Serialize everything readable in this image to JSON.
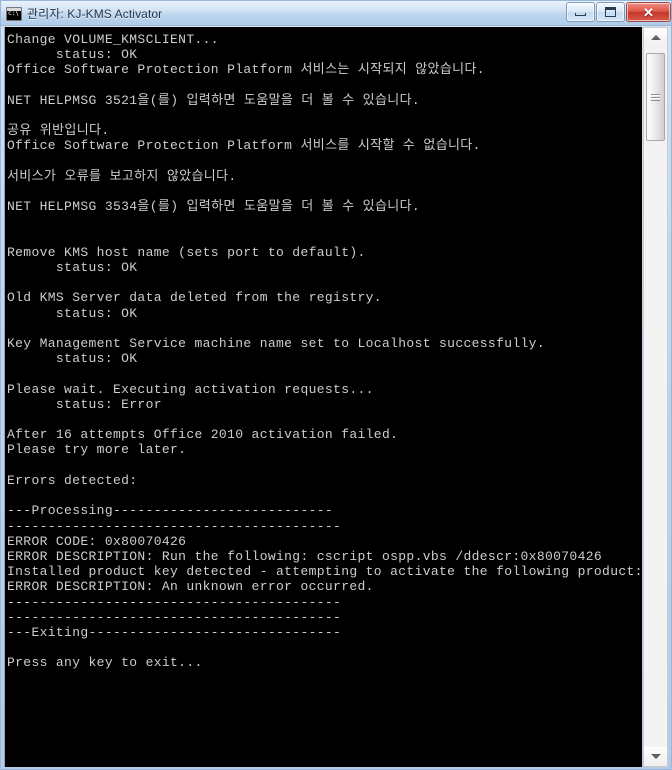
{
  "window": {
    "title": "관리자:  KJ-KMS Activator",
    "icon": "cmd-console-icon"
  },
  "caption_buttons": {
    "minimize_label": "",
    "maximize_label": "",
    "close_label": "✕"
  },
  "scrollbar": {
    "up_arrow": "scroll-up-arrow",
    "down_arrow": "scroll-down-arrow",
    "thumb": "scroll-thumb"
  },
  "console": {
    "lines": [
      "Change VOLUME_KMSCLIENT...",
      "      status: OK",
      "Office Software Protection Platform 서비스는 시작되지 않았습니다.",
      "",
      "NET HELPMSG 3521을(를) 입력하면 도움말을 더 볼 수 있습니다.",
      "",
      "공유 위반입니다.",
      "Office Software Protection Platform 서비스를 시작할 수 없습니다.",
      "",
      "서비스가 오류를 보고하지 않았습니다.",
      "",
      "NET HELPMSG 3534을(를) 입력하면 도움말을 더 볼 수 있습니다.",
      "",
      "",
      "Remove KMS host name (sets port to default).",
      "      status: OK",
      "",
      "Old KMS Server data deleted from the registry.",
      "      status: OK",
      "",
      "Key Management Service machine name set to Localhost successfully.",
      "      status: OK",
      "",
      "Please wait. Executing activation requests...",
      "      status: Error",
      "",
      "After 16 attempts Office 2010 activation failed.",
      "Please try more later.",
      "",
      "Errors detected:",
      "",
      "---Processing---------------------------",
      "-----------------------------------------",
      "ERROR CODE: 0x80070426",
      "ERROR DESCRIPTION: Run the following: cscript ospp.vbs /ddescr:0x80070426",
      "Installed product key detected - attempting to activate the following product:",
      "ERROR DESCRIPTION: An unknown error occurred.",
      "-----------------------------------------",
      "-----------------------------------------",
      "---Exiting-------------------------------",
      "",
      "Press any key to exit..."
    ]
  },
  "colors": {
    "console_background": "#000000",
    "console_foreground": "#cdcdcd",
    "frame": "#b3cbe6",
    "close_button": "#c4392c"
  }
}
